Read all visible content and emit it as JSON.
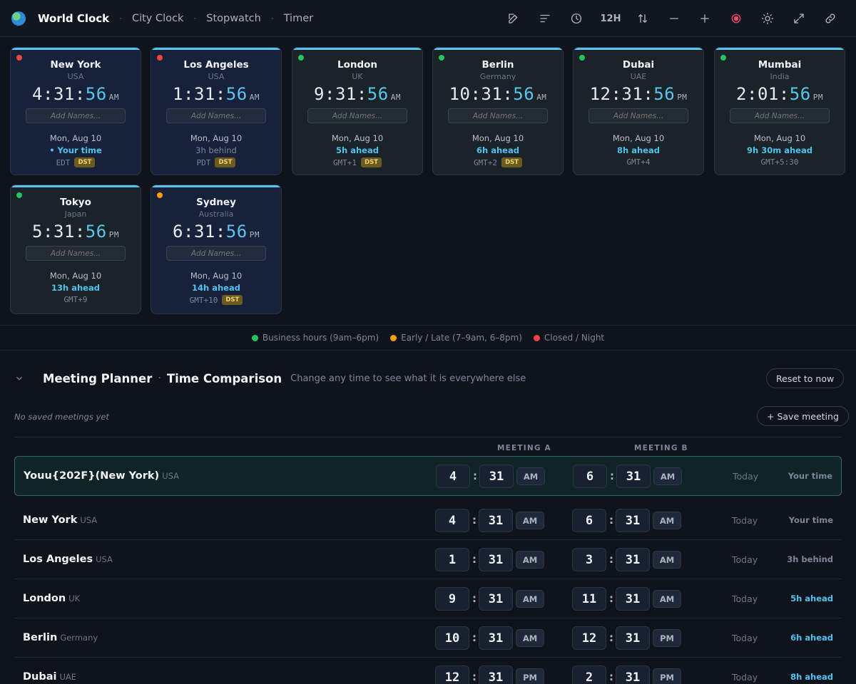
{
  "app": {
    "title": "World Clock"
  },
  "nav": {
    "items": [
      "City Clock",
      "Stopwatch",
      "Timer"
    ]
  },
  "toolbar": {
    "format_label": "12H"
  },
  "colors": {
    "business": "#22c55e",
    "early_late": "#f59e0b",
    "closed": "#ef4444",
    "accent": "#5bc3ec"
  },
  "cards": [
    {
      "city": "New York",
      "country": "USA",
      "h": "4",
      "m": "31",
      "s": "56",
      "ampm": "AM",
      "placeholder": "Add Names...",
      "date": "Mon, Aug 10",
      "offset": "• Your time",
      "tz": "EDT",
      "dst": "DST",
      "status": "closed"
    },
    {
      "city": "Los Angeles",
      "country": "USA",
      "h": "1",
      "m": "31",
      "s": "56",
      "ampm": "AM",
      "placeholder": "Add Names...",
      "date": "Mon, Aug 10",
      "offset": "3h behind",
      "tz": "PDT",
      "dst": "DST",
      "status": "closed"
    },
    {
      "city": "London",
      "country": "UK",
      "h": "9",
      "m": "31",
      "s": "56",
      "ampm": "AM",
      "placeholder": "Add Names...",
      "date": "Mon, Aug 10",
      "offset": "5h ahead",
      "tz": "GMT+1",
      "dst": "DST",
      "status": "business"
    },
    {
      "city": "Berlin",
      "country": "Germany",
      "h": "10",
      "m": "31",
      "s": "56",
      "ampm": "AM",
      "placeholder": "Add Names...",
      "date": "Mon, Aug 10",
      "offset": "6h ahead",
      "tz": "GMT+2",
      "dst": "DST",
      "status": "business"
    },
    {
      "city": "Dubai",
      "country": "UAE",
      "h": "12",
      "m": "31",
      "s": "56",
      "ampm": "PM",
      "placeholder": "Add Names...",
      "date": "Mon, Aug 10",
      "offset": "8h ahead",
      "tz": "GMT+4",
      "dst": "",
      "status": "business"
    },
    {
      "city": "Mumbai",
      "country": "India",
      "h": "2",
      "m": "01",
      "s": "56",
      "ampm": "PM",
      "placeholder": "Add Names...",
      "date": "Mon, Aug 10",
      "offset": "9h 30m ahead",
      "tz": "GMT+5:30",
      "dst": "",
      "status": "business"
    },
    {
      "city": "Tokyo",
      "country": "Japan",
      "h": "5",
      "m": "31",
      "s": "56",
      "ampm": "PM",
      "placeholder": "Add Names...",
      "date": "Mon, Aug 10",
      "offset": "13h ahead",
      "tz": "GMT+9",
      "dst": "",
      "status": "business"
    },
    {
      "city": "Sydney",
      "country": "Australia",
      "h": "6",
      "m": "31",
      "s": "56",
      "ampm": "PM",
      "placeholder": "Add Names...",
      "date": "Mon, Aug 10",
      "offset": "14h ahead",
      "tz": "GMT+10",
      "dst": "DST",
      "status": "early_late"
    }
  ],
  "legend": {
    "business": "Business hours (9am–6pm)",
    "early_late": "Early / Late (7–9am, 6–8pm)",
    "closed": "Closed / Night"
  },
  "planner": {
    "title": "Meeting Planner",
    "sep": "·",
    "subtitle_strong": "Time Comparison",
    "hint": "Change any time to see what it is everywhere else",
    "reset_label": "Reset to now",
    "save_label": "+ Save meeting",
    "empty_saved": "No saved meetings yet",
    "col_a": "MEETING A",
    "col_b": "MEETING B",
    "rows": [
      {
        "city": "Youu{202F}(New York)",
        "country": "USA",
        "a_h": "4",
        "a_m": "31",
        "a_ampm": "AM",
        "b_h": "6",
        "b_m": "31",
        "b_ampm": "AM",
        "day": "Today",
        "rel": "Your time",
        "rel_type": "self"
      },
      {
        "city": "New York",
        "country": "USA",
        "a_h": "4",
        "a_m": "31",
        "a_ampm": "AM",
        "b_h": "6",
        "b_m": "31",
        "b_ampm": "AM",
        "day": "Today",
        "rel": "Your time",
        "rel_type": "self"
      },
      {
        "city": "Los Angeles",
        "country": "USA",
        "a_h": "1",
        "a_m": "31",
        "a_ampm": "AM",
        "b_h": "3",
        "b_m": "31",
        "b_ampm": "AM",
        "day": "Today",
        "rel": "3h behind",
        "rel_type": "behind"
      },
      {
        "city": "London",
        "country": "UK",
        "a_h": "9",
        "a_m": "31",
        "a_ampm": "AM",
        "b_h": "11",
        "b_m": "31",
        "b_ampm": "AM",
        "day": "Today",
        "rel": "5h ahead",
        "rel_type": "ahead"
      },
      {
        "city": "Berlin",
        "country": "Germany",
        "a_h": "10",
        "a_m": "31",
        "a_ampm": "AM",
        "b_h": "12",
        "b_m": "31",
        "b_ampm": "PM",
        "day": "Today",
        "rel": "6h ahead",
        "rel_type": "ahead"
      },
      {
        "city": "Dubai",
        "country": "UAE",
        "a_h": "12",
        "a_m": "31",
        "a_ampm": "PM",
        "b_h": "2",
        "b_m": "31",
        "b_ampm": "PM",
        "day": "Today",
        "rel": "8h ahead",
        "rel_type": "ahead"
      }
    ]
  }
}
